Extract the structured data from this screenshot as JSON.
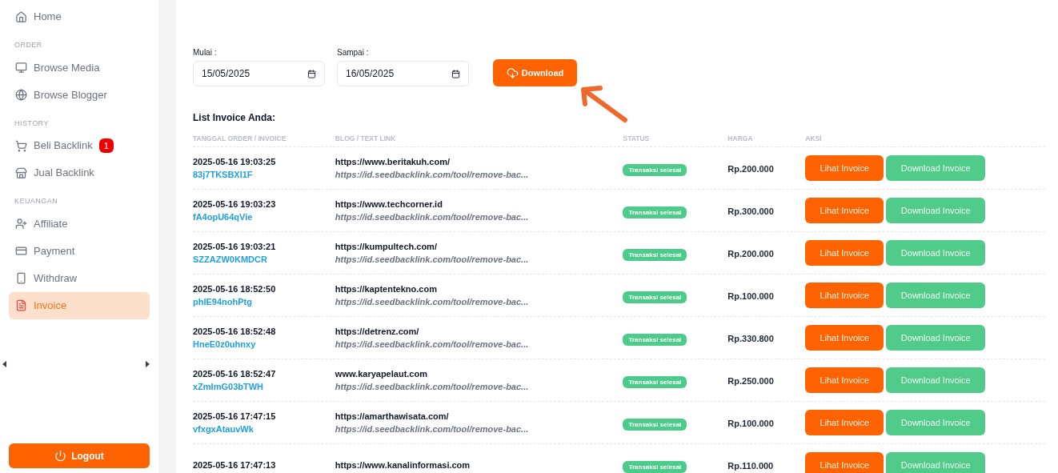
{
  "sidebar": {
    "items": [
      {
        "kind": "link",
        "label": "Home",
        "selected": false
      },
      {
        "kind": "section",
        "label": "ORDER"
      },
      {
        "kind": "link",
        "label": "Browse Media",
        "selected": false
      },
      {
        "kind": "link",
        "label": "Browse Blogger",
        "selected": false
      },
      {
        "kind": "section",
        "label": "HISTORY"
      },
      {
        "kind": "link",
        "label": "Beli Backlink",
        "badge": "1",
        "selected": false
      },
      {
        "kind": "link",
        "label": "Jual Backlink",
        "selected": false
      },
      {
        "kind": "section",
        "label": "KEUANGAN"
      },
      {
        "kind": "link",
        "label": "Affiliate",
        "selected": false
      },
      {
        "kind": "link",
        "label": "Payment",
        "selected": false
      },
      {
        "kind": "link",
        "label": "Withdraw",
        "selected": false
      },
      {
        "kind": "link",
        "label": "Invoice",
        "selected": true
      }
    ],
    "logout": "Logout"
  },
  "filter": {
    "start_label": "Mulai :",
    "start_value": "15/05/2025",
    "end_label": "Sampai :",
    "end_value": "16/05/2025",
    "download": "Download"
  },
  "table": {
    "title": "List Invoice Anda:",
    "columns": [
      "TANGGAL ORDER / INVOICE",
      "BLOG / TEXT LINK",
      "STATUS",
      "HARGA",
      "AKSI"
    ],
    "rows": [
      {
        "date": "2025-05-16 19:03:25",
        "invoice": "83j7TKSBXI1F",
        "blog": "https://www.beritakuh.com/",
        "link": "https://id.seedbacklink.com/tool/remove-bac...",
        "status": "Transaksi selesai",
        "price": "Rp.200.000",
        "view": "Lihat Invoice",
        "download": "Download Invoice"
      },
      {
        "date": "2025-05-16 19:03:23",
        "invoice": "fA4opU64qVie",
        "blog": "https://www.techcorner.id",
        "link": "https://id.seedbacklink.com/tool/remove-bac...",
        "status": "Transaksi selesai",
        "price": "Rp.300.000",
        "view": "Lihat Invoice",
        "download": "Download Invoice"
      },
      {
        "date": "2025-05-16 19:03:21",
        "invoice": "SZZAZW0KMDCR",
        "blog": "https://kumpultech.com/",
        "link": "https://id.seedbacklink.com/tool/remove-bac...",
        "status": "Transaksi selesai",
        "price": "Rp.200.000",
        "view": "Lihat Invoice",
        "download": "Download Invoice"
      },
      {
        "date": "2025-05-16 18:52:50",
        "invoice": "phlE94nohPtg",
        "blog": "https://kaptentekno.com",
        "link": "https://id.seedbacklink.com/tool/remove-bac...",
        "status": "Transaksi selesai",
        "price": "Rp.100.000",
        "view": "Lihat Invoice",
        "download": "Download Invoice"
      },
      {
        "date": "2025-05-16 18:52:48",
        "invoice": "HneE0z0uhnxy",
        "blog": "https://detrenz.com/",
        "link": "https://id.seedbacklink.com/tool/remove-bac...",
        "status": "Transaksi selesai",
        "price": "Rp.330.800",
        "view": "Lihat Invoice",
        "download": "Download Invoice"
      },
      {
        "date": "2025-05-16 18:52:47",
        "invoice": "xZmImG03bTWH",
        "blog": "www.karyapelaut.com",
        "link": "https://id.seedbacklink.com/tool/remove-bac...",
        "status": "Transaksi selesai",
        "price": "Rp.250.000",
        "view": "Lihat Invoice",
        "download": "Download Invoice"
      },
      {
        "date": "2025-05-16 17:47:15",
        "invoice": "vfxgxAtauvWk",
        "blog": "https://amarthawisata.com/",
        "link": "https://id.seedbacklink.com/tool/remove-bac...",
        "status": "Transaksi selesai",
        "price": "Rp.100.000",
        "view": "Lihat Invoice",
        "download": "Download Invoice"
      },
      {
        "date": "2025-05-16 17:47:13",
        "blog": "https://www.kanalinformasi.com",
        "status": "Transaksi selesai",
        "price": "Rp.110.000",
        "view": "Lihat Invoice",
        "download": "Download Invoice"
      }
    ]
  }
}
